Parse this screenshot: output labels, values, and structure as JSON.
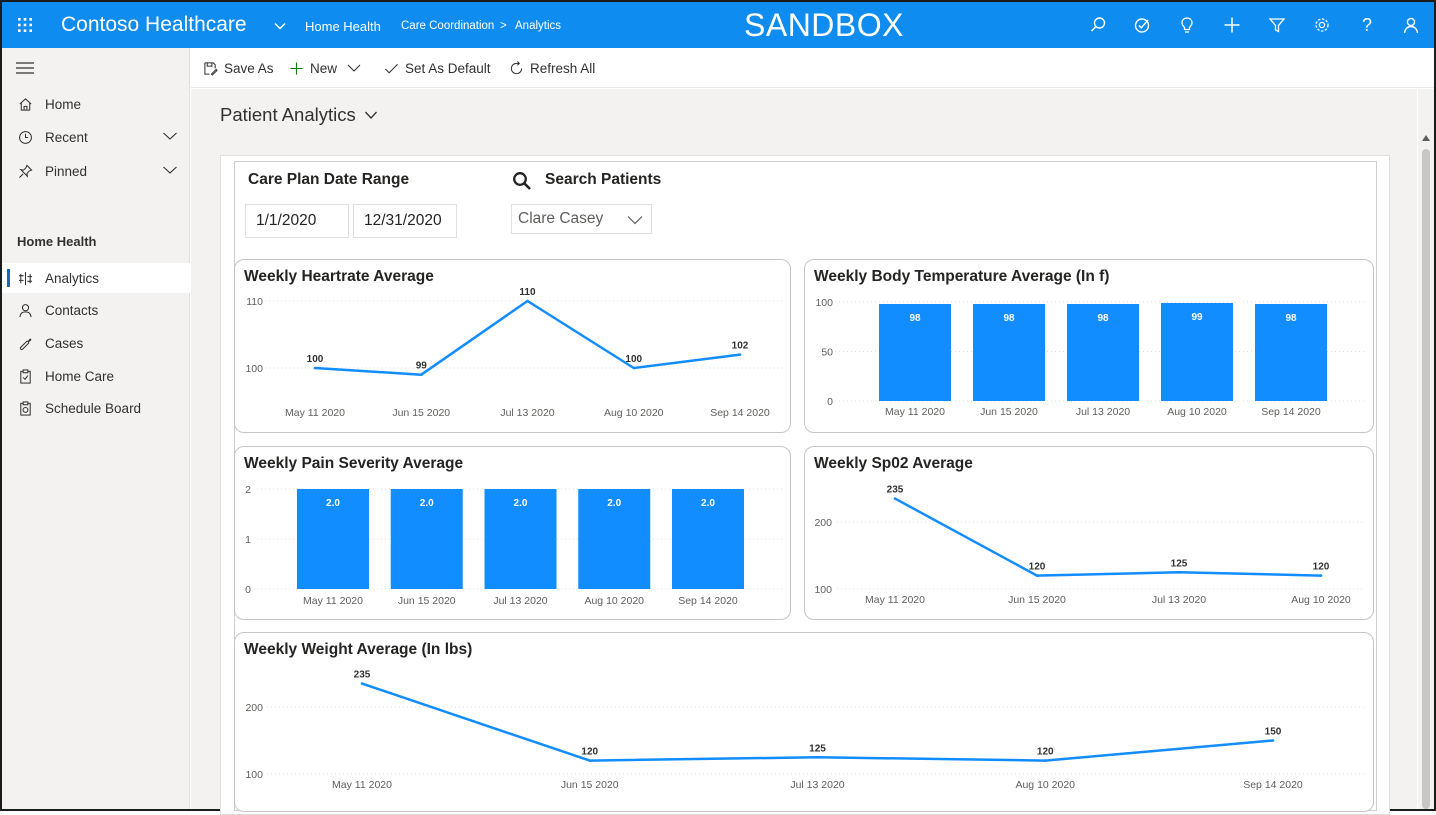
{
  "topbar": {
    "app_title": "Contoso Healthcare",
    "area": "Home Health",
    "breadcrumb_parent": "Care Coordination",
    "breadcrumb_separator": ">",
    "breadcrumb_current": "Analytics",
    "environment": "SANDBOX",
    "icons": [
      "search-icon",
      "task-icon",
      "lightbulb-icon",
      "plus-icon",
      "filter-icon",
      "gear-icon",
      "help-icon",
      "user-icon"
    ],
    "help_glyph": "?"
  },
  "sidebar": {
    "items": [
      {
        "label": "Home",
        "icon": "home-icon"
      },
      {
        "label": "Recent",
        "icon": "clock-icon"
      },
      {
        "label": "Pinned",
        "icon": "pin-icon"
      }
    ],
    "section_title": "Home Health",
    "section_items": [
      {
        "label": "Analytics",
        "icon": "analytics-icon",
        "active": true
      },
      {
        "label": "Contacts",
        "icon": "person-icon"
      },
      {
        "label": "Cases",
        "icon": "wrench-icon"
      },
      {
        "label": "Home Care",
        "icon": "clipboard-icon"
      },
      {
        "label": "Schedule Board",
        "icon": "schedule-icon"
      }
    ]
  },
  "commandbar": {
    "save_as": "Save As",
    "new": "New",
    "set_default": "Set As Default",
    "refresh_all": "Refresh All"
  },
  "page": {
    "title": "Patient Analytics"
  },
  "filters": {
    "date_range_label": "Care Plan Date Range",
    "start_date": "1/1/2020",
    "end_date": "12/31/2020",
    "search_label": "Search Patients",
    "patient": "Clare Casey"
  },
  "colors": {
    "brand": "#0f8cf0",
    "series": "#118dff"
  },
  "chart_data": [
    {
      "id": "heartrate",
      "type": "line",
      "title": "Weekly Heartrate Average",
      "categories": [
        "May 11 2020",
        "Jun 15 2020",
        "Jul 13 2020",
        "Aug 10 2020",
        "Sep 14 2020"
      ],
      "values": [
        100,
        99,
        110,
        100,
        102
      ],
      "labels": [
        "100",
        "99",
        "110",
        "100",
        "102"
      ],
      "yticks": [
        100,
        110
      ],
      "ylim": [
        94,
        111
      ]
    },
    {
      "id": "temperature",
      "type": "bar",
      "title": "Weekly Body Temperature Average (In f)",
      "categories": [
        "May 11 2020",
        "Jun 15 2020",
        "Jul 13 2020",
        "Aug 10 2020",
        "Sep 14 2020"
      ],
      "values": [
        98,
        98,
        98,
        99,
        98
      ],
      "labels": [
        "98",
        "98",
        "98",
        "99",
        "98"
      ],
      "yticks": [
        0,
        50,
        100
      ],
      "ylim": [
        0,
        100
      ]
    },
    {
      "id": "pain",
      "type": "bar",
      "title": "Weekly Pain Severity Average",
      "categories": [
        "May 11 2020",
        "Jun 15 2020",
        "Jul 13 2020",
        "Aug 10 2020",
        "Sep 14 2020"
      ],
      "values": [
        2,
        2,
        2,
        2,
        2
      ],
      "labels": [
        "2.0",
        "2.0",
        "2.0",
        "2.0",
        "2.0"
      ],
      "yticks": [
        0,
        1,
        2
      ],
      "ylim": [
        0,
        2
      ]
    },
    {
      "id": "spo2",
      "type": "line",
      "title": "Weekly Sp02 Average",
      "categories": [
        "May 11 2020",
        "Jun 15 2020",
        "Jul 13 2020",
        "Aug 10 2020"
      ],
      "values": [
        235,
        120,
        125,
        120
      ],
      "labels": [
        "235",
        "120",
        "125",
        "120"
      ],
      "yticks": [
        100,
        200
      ],
      "ylim": [
        100,
        240
      ]
    },
    {
      "id": "weight",
      "type": "line",
      "title": "Weekly Weight Average (In lbs)",
      "categories": [
        "May 11 2020",
        "Jun 15 2020",
        "Jul 13 2020",
        "Aug 10 2020",
        "Sep 14 2020"
      ],
      "values": [
        235,
        120,
        125,
        120,
        150
      ],
      "labels": [
        "235",
        "120",
        "125",
        "120",
        "150"
      ],
      "yticks": [
        100,
        200
      ],
      "ylim": [
        100,
        240
      ]
    }
  ]
}
